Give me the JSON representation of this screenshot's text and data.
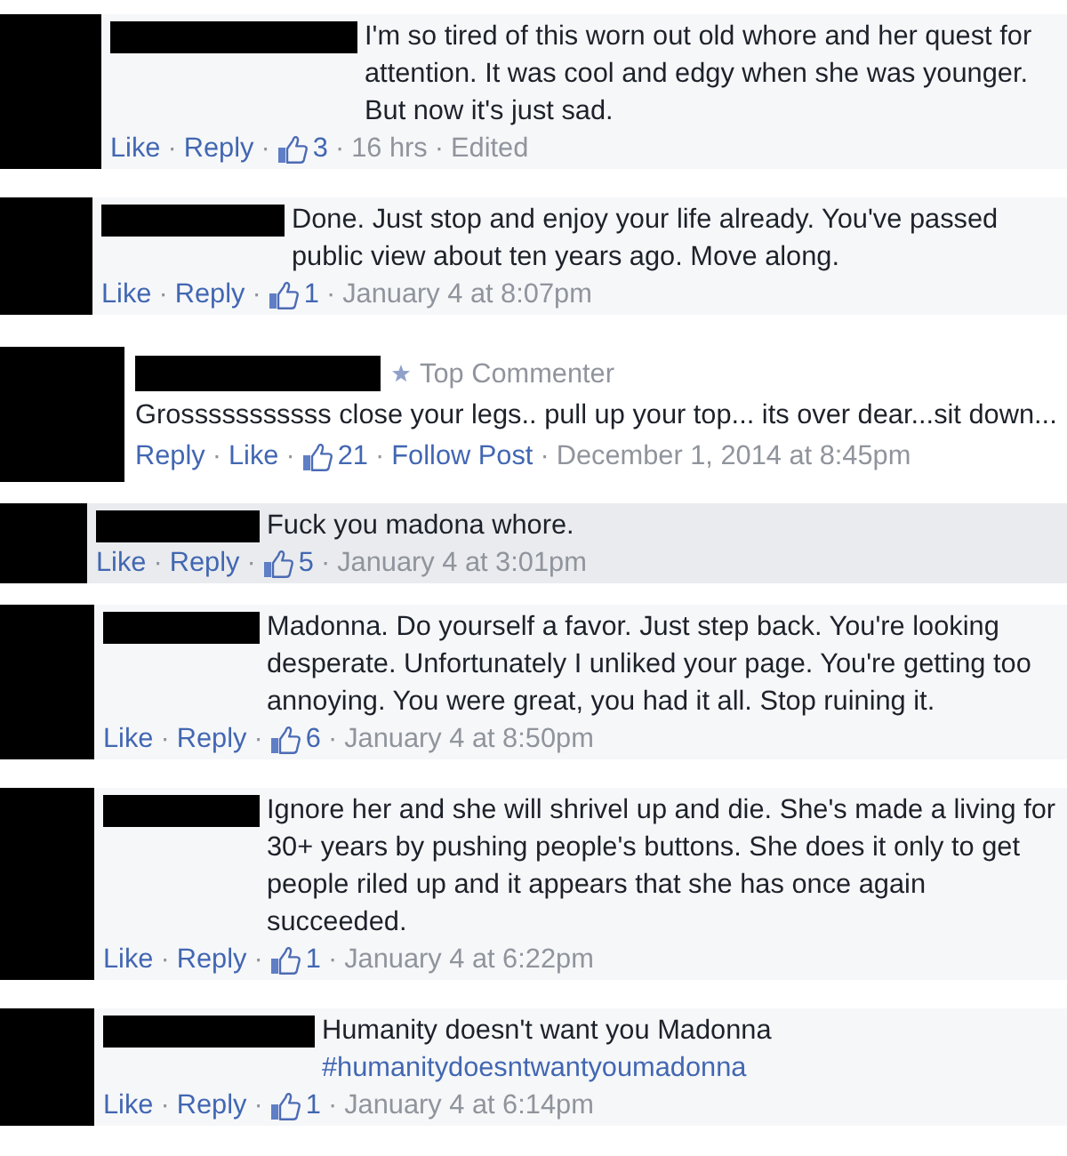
{
  "comments": [
    {
      "kind": "inline",
      "highlighted": false,
      "text": "I'm so tired of this worn out old whore and her quest for attention. It was cool and edgy when she was younger. But now it's just sad.",
      "actions": [
        {
          "kind": "like",
          "text": "Like"
        },
        {
          "kind": "dot",
          "text": "·"
        },
        {
          "kind": "reply",
          "text": "Reply"
        },
        {
          "kind": "dot",
          "text": "·"
        },
        {
          "kind": "likes",
          "text": "3"
        },
        {
          "kind": "dot",
          "text": "·"
        },
        {
          "kind": "time",
          "text": "16 hrs"
        },
        {
          "kind": "dot",
          "text": "·"
        },
        {
          "kind": "edited",
          "text": "Edited"
        }
      ]
    },
    {
      "kind": "inline",
      "highlighted": false,
      "text": "Done. Just stop and enjoy your life already. You've passed public view about ten years ago. Move along.",
      "actions": [
        {
          "kind": "like",
          "text": "Like"
        },
        {
          "kind": "dot",
          "text": "·"
        },
        {
          "kind": "reply",
          "text": "Reply"
        },
        {
          "kind": "dot",
          "text": "·"
        },
        {
          "kind": "likes",
          "text": "1"
        },
        {
          "kind": "dot",
          "text": "·"
        },
        {
          "kind": "time",
          "text": "January 4 at 8:07pm"
        }
      ]
    },
    {
      "kind": "stacked",
      "highlighted": false,
      "badge": {
        "text": "Top Commenter"
      },
      "text": "Grosssssssssss close your legs.. pull up your top... its over dear...sit down...",
      "actions": [
        {
          "kind": "reply",
          "text": "Reply"
        },
        {
          "kind": "dot",
          "text": "·"
        },
        {
          "kind": "like",
          "text": "Like"
        },
        {
          "kind": "dot",
          "text": "·"
        },
        {
          "kind": "likes",
          "text": "21"
        },
        {
          "kind": "dot",
          "text": "·"
        },
        {
          "kind": "follow",
          "text": "Follow Post"
        },
        {
          "kind": "dot",
          "text": "·"
        },
        {
          "kind": "time",
          "text": "December 1, 2014 at 8:45pm"
        }
      ]
    },
    {
      "kind": "inline",
      "highlighted": true,
      "text": "Fuck you madona whore.",
      "actions": [
        {
          "kind": "like",
          "text": "Like"
        },
        {
          "kind": "dot",
          "text": "·"
        },
        {
          "kind": "reply",
          "text": "Reply"
        },
        {
          "kind": "dot",
          "text": "·"
        },
        {
          "kind": "likes",
          "text": "5"
        },
        {
          "kind": "dot",
          "text": "·"
        },
        {
          "kind": "time",
          "text": "January 4 at 3:01pm"
        }
      ]
    },
    {
      "kind": "inline",
      "highlighted": false,
      "text": "Madonna. Do yourself a favor. Just step back. You're looking desperate. Unfortunately I unliked your page. You're getting too annoying. You were great, you had it all. Stop ruining it.",
      "actions": [
        {
          "kind": "like",
          "text": "Like"
        },
        {
          "kind": "dot",
          "text": "·"
        },
        {
          "kind": "reply",
          "text": "Reply"
        },
        {
          "kind": "dot",
          "text": "·"
        },
        {
          "kind": "likes",
          "text": "6"
        },
        {
          "kind": "dot",
          "text": "·"
        },
        {
          "kind": "time",
          "text": "January 4 at 8:50pm"
        }
      ]
    },
    {
      "kind": "inline",
      "highlighted": false,
      "text": "Ignore her and she will shrivel up and die. She's made a living for 30+ years by pushing people's buttons. She does it only to get people riled up and it appears that she has once again succeeded.",
      "actions": [
        {
          "kind": "like",
          "text": "Like"
        },
        {
          "kind": "dot",
          "text": "·"
        },
        {
          "kind": "reply",
          "text": "Reply"
        },
        {
          "kind": "dot",
          "text": "·"
        },
        {
          "kind": "likes",
          "text": "1"
        },
        {
          "kind": "dot",
          "text": "·"
        },
        {
          "kind": "time",
          "text": "January 4 at 6:22pm"
        }
      ]
    },
    {
      "kind": "inline",
      "highlighted": false,
      "text": "Humanity doesn't want you Madonna",
      "hashtag": "#humanitydoesntwantyoumadonna",
      "actions": [
        {
          "kind": "like",
          "text": "Like"
        },
        {
          "kind": "dot",
          "text": "·"
        },
        {
          "kind": "reply",
          "text": "Reply"
        },
        {
          "kind": "dot",
          "text": "·"
        },
        {
          "kind": "likes",
          "text": "1"
        },
        {
          "kind": "dot",
          "text": "·"
        },
        {
          "kind": "time",
          "text": "January 4 at 6:14pm"
        }
      ]
    }
  ]
}
